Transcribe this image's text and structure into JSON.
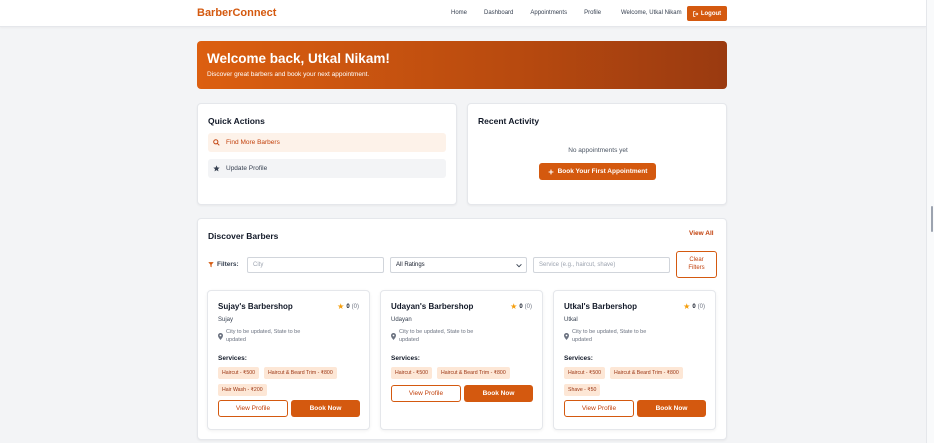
{
  "colors": {
    "accent": "#d4590f",
    "accent_light": "#fdf2e9",
    "star": "#f59e0b"
  },
  "nav": {
    "brand": "BarberConnect",
    "links": [
      "Home",
      "Dashboard",
      "Appointments",
      "Profile"
    ],
    "welcome": "Welcome, Utkal Nikam",
    "logout_icon": "logout-icon",
    "logout_label": "Logout"
  },
  "banner": {
    "title": "Welcome back, Utkal Nikam!",
    "subtitle": "Discover great barbers and book your next appointment."
  },
  "quick_actions": {
    "title": "Quick Actions",
    "items": [
      {
        "icon": "search-icon",
        "label": "Find More Barbers"
      },
      {
        "icon": "star-icon",
        "label": "Update Profile"
      }
    ]
  },
  "recent_activity": {
    "title": "Recent Activity",
    "empty_text": "No appointments yet",
    "cta_icon": "plus-icon",
    "cta_label": "Book Your First Appointment"
  },
  "discover": {
    "title": "Discover Barbers",
    "view_all": "View All",
    "filters": {
      "label": "Filters:",
      "icon": "filter-icon",
      "city_placeholder": "City",
      "rating_selected": "All Ratings",
      "service_placeholder": "Service (e.g., haircut, shave)",
      "clear_line1": "Clear",
      "clear_line2": "Filters"
    },
    "services_label": "Services:",
    "view_profile_label": "View Profile",
    "book_label": "Book Now",
    "barbers": [
      {
        "name": "Sujay's Barbershop",
        "owner": "Sujay",
        "rating": "0",
        "rating_count": "(0)",
        "location_line1": "City to be updated, State to be",
        "location_line2": "updated",
        "services": [
          "Haircut - ₹500",
          "Haircut & Beard Trim - ₹800",
          "Hair Wash - ₹200"
        ]
      },
      {
        "name": "Udayan's Barbershop",
        "owner": "Udayan",
        "rating": "0",
        "rating_count": "(0)",
        "location_line1": "City to be updated, State to be",
        "location_line2": "updated",
        "services": [
          "Haircut - ₹500",
          "Haircut & Beard Trim - ₹800"
        ]
      },
      {
        "name": "Utkal's Barbershop",
        "owner": "Utkal",
        "rating": "0",
        "rating_count": "(0)",
        "location_line1": "City to be updated, State to be",
        "location_line2": "updated",
        "services": [
          "Haircut - ₹500",
          "Haircut & Beard Trim - ₹800",
          "Shave - ₹50"
        ]
      }
    ]
  }
}
